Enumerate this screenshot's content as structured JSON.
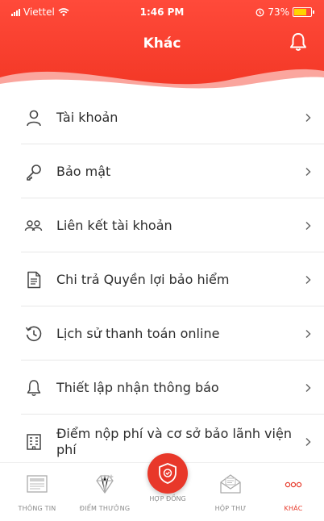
{
  "status_bar": {
    "carrier": "Viettel",
    "time": "1:46 PM",
    "battery": "73%",
    "battery_level": 0.73
  },
  "header": {
    "title": "Khác",
    "bell_icon": "bell-icon",
    "accent_color": "#f23624"
  },
  "menu": {
    "items": [
      {
        "label": "Tài khoản",
        "icon": "user-icon"
      },
      {
        "label": "Bảo mật",
        "icon": "key-icon"
      },
      {
        "label": "Liên kết tài khoản",
        "icon": "link-accounts-icon"
      },
      {
        "label": "Chi trả Quyền lợi bảo hiểm",
        "icon": "document-icon"
      },
      {
        "label": "Lịch sử thanh toán online",
        "icon": "history-icon"
      },
      {
        "label": "Thiết lập nhận thông báo",
        "icon": "bell-icon"
      },
      {
        "label": "Điểm nộp phí và cơ sở bảo lãnh viện phí",
        "icon": "building-icon"
      }
    ]
  },
  "tabs": [
    {
      "label": "THÔNG TIN",
      "icon": "news-icon"
    },
    {
      "label": "ĐIỂM THƯỞNG",
      "icon": "diamond-icon"
    },
    {
      "label": "HỢP ĐỒNG",
      "icon": "contract-shield-icon"
    },
    {
      "label": "HỘP THƯ",
      "icon": "mail-icon"
    },
    {
      "label": "KHÁC",
      "icon": "more-icon",
      "active": true
    }
  ]
}
